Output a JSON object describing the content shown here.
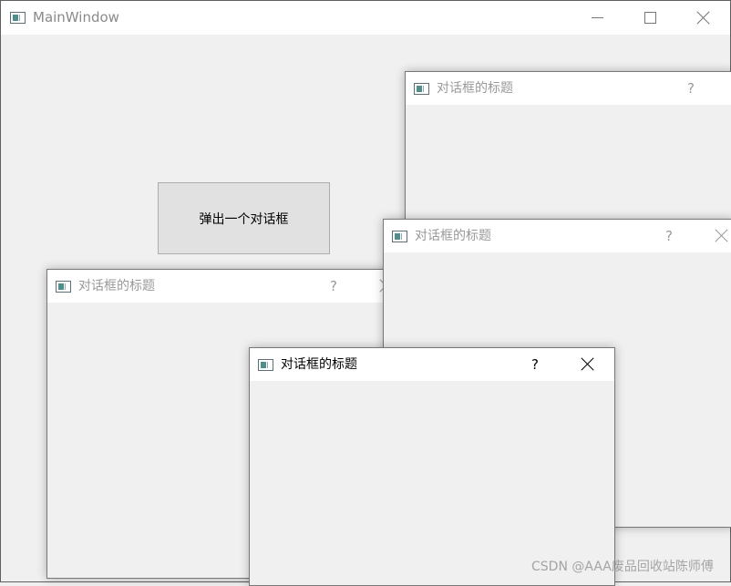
{
  "main_window": {
    "title": "MainWindow",
    "icon": "app-window-icon",
    "popup_button_label": "弹出一个对话框"
  },
  "dialogs": [
    {
      "title": "对话框的标题",
      "help": "?",
      "state": "inactive"
    },
    {
      "title": "对话框的标题",
      "help": "?",
      "state": "inactive"
    },
    {
      "title": "对话框的标题",
      "help": "?",
      "state": "inactive"
    },
    {
      "title": "对话框的标题",
      "help": "?",
      "state": "active"
    }
  ],
  "watermark": "CSDN @AAA废品回收站陈师傅",
  "colors": {
    "window_background": "#f0f0f0",
    "titlebar_background": "#ffffff",
    "button_background": "#e1e1e1",
    "inactive_text": "#999999",
    "active_text": "#000000"
  }
}
